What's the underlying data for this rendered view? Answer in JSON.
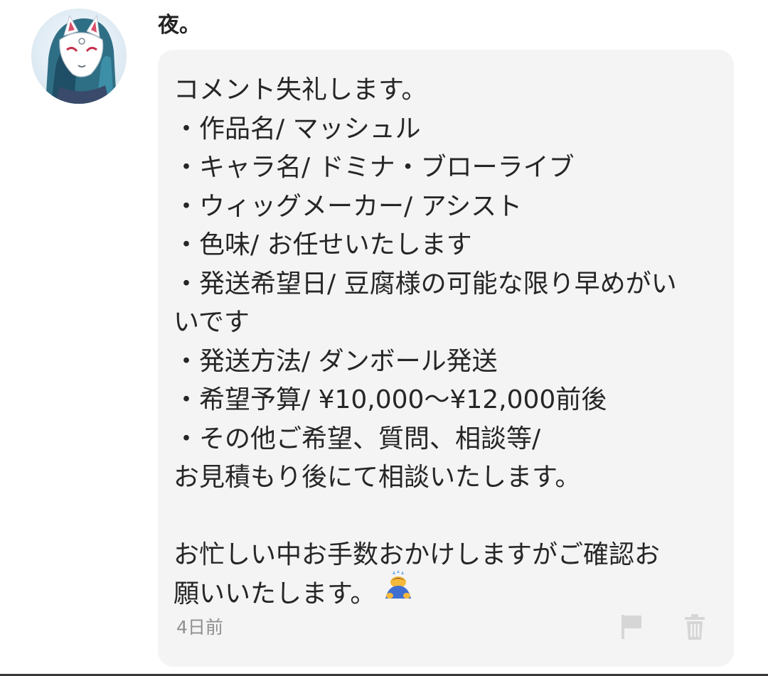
{
  "comment": {
    "username": "夜。",
    "message_lines": [
      "コメント失礼します。",
      "・作品名/ マッシュル",
      "・キャラ名/ ドミナ・ブローライブ",
      "・ウィッグメーカー/ アシスト",
      "・色味/ お任せいたします",
      "・発送希望日/ 豆腐様の可能な限り早めがい",
      "いです",
      "・発送方法/ ダンボール発送",
      "・希望予算/ ¥10,000〜¥12,000前後",
      "・その他ご希望、質問、相談等/",
      "お見積もり後にて相談いたします。",
      "",
      "お忙しい中お手数おかけしますがご確認お",
      "願いいたします。"
    ],
    "timestamp": "4日前",
    "icons": {
      "avatar": "fox-mask-avatar",
      "emoji": "bowing-person-emoji",
      "flag": "flag-icon",
      "trash": "trash-icon"
    },
    "colors": {
      "bubble_background": "#f4f4f4",
      "timestamp_text": "#8f8f8f",
      "action_icon": "#d4d4d4"
    }
  }
}
